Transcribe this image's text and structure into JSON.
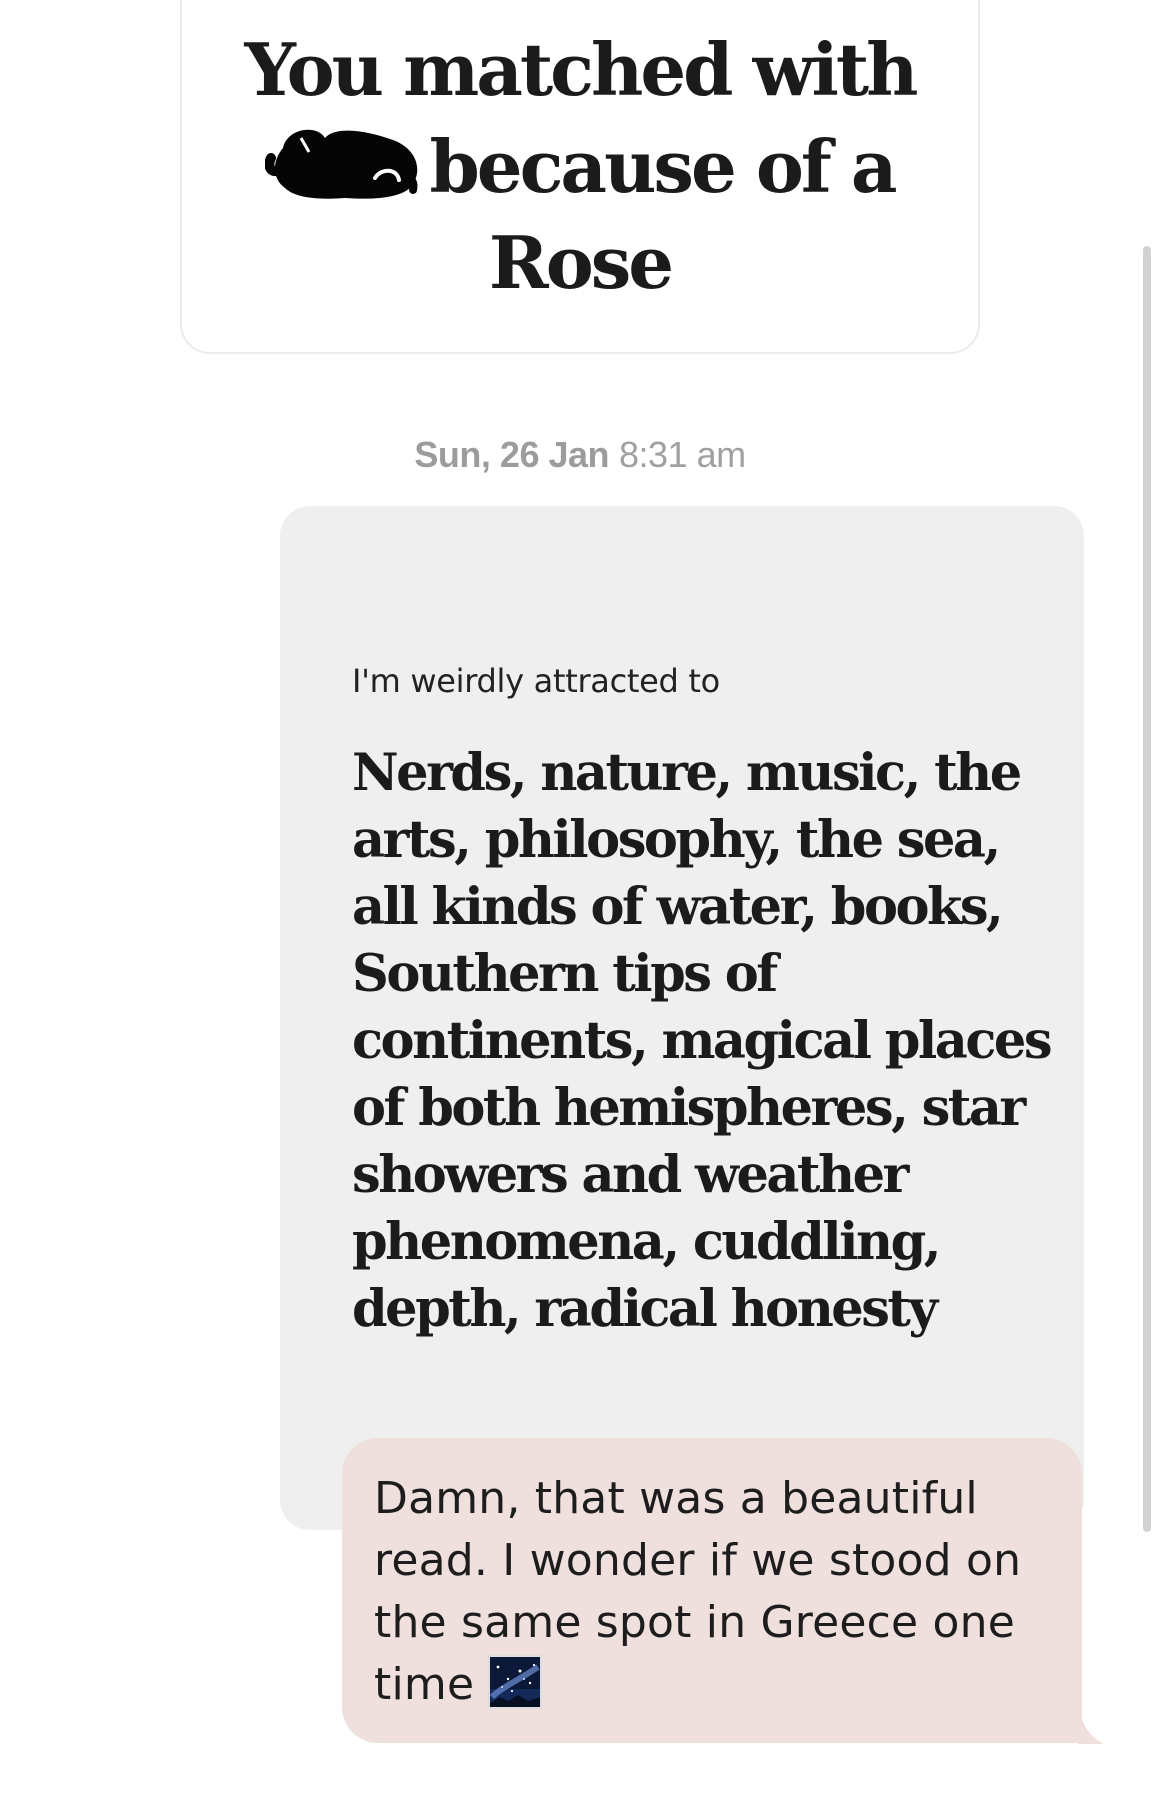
{
  "match_card": {
    "title_line1": "You matched with",
    "title_line2_after_redaction": "because of a",
    "title_line3": "Rose"
  },
  "timestamp": {
    "date": "Sun, 26 Jan",
    "time": "8:31 am"
  },
  "prompt": {
    "label": "I'm weirdly attracted to",
    "answer": "Nerds, nature, music, the arts, philosophy, the sea, all kinds of water, books, Southern tips of continents, magical places of both hemispheres, star showers and weather phenomena, cuddling, depth, radical honesty"
  },
  "message": {
    "text": "Damn, that was a beautiful read. I wonder if we stood on the same spot in Greece one time",
    "emoji_icon": "milky-way-icon"
  },
  "colors": {
    "prompt_card_bg": "#efefef",
    "message_bubble_bg": "#efe0dd",
    "timestamp_text": "#a0a0a0"
  }
}
